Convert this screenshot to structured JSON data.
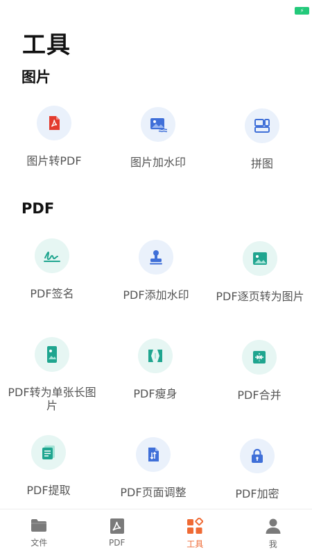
{
  "status": {
    "battery_glyph": "⚡"
  },
  "page_title": "工具",
  "sections": [
    {
      "title": "图片",
      "tools": [
        {
          "label": "图片转PDF",
          "icon": "pdf-file-icon"
        },
        {
          "label": "图片加水印",
          "icon": "image-watermark-icon"
        },
        {
          "label": "拼图",
          "icon": "collage-icon"
        }
      ]
    },
    {
      "title": "PDF",
      "tools": [
        {
          "label": "PDF签名",
          "icon": "signature-icon"
        },
        {
          "label": "PDF添加水印",
          "icon": "stamp-icon"
        },
        {
          "label": "PDF逐页转为图片",
          "icon": "image-icon"
        },
        {
          "label": "PDF转为单张长图片",
          "icon": "long-image-icon"
        },
        {
          "label": "PDF瘦身",
          "icon": "compress-icon"
        },
        {
          "label": "PDF合并",
          "icon": "merge-icon"
        },
        {
          "label": "PDF提取",
          "icon": "extract-icon"
        },
        {
          "label": "PDF页面调整",
          "icon": "page-adjust-icon"
        },
        {
          "label": "PDF加密",
          "icon": "lock-icon"
        }
      ]
    }
  ],
  "tabbar": {
    "active": "tools",
    "items": [
      {
        "id": "files",
        "label": "文件",
        "icon": "folder-icon"
      },
      {
        "id": "pdf",
        "label": "PDF",
        "icon": "pdf-icon"
      },
      {
        "id": "tools",
        "label": "工具",
        "icon": "tools-grid-icon"
      },
      {
        "id": "me",
        "label": "我",
        "icon": "user-icon"
      }
    ]
  },
  "colors": {
    "accent_orange": "#ef6a34",
    "pdf_red": "#e33b2e",
    "icon_blue": "#3f6fd8",
    "icon_teal": "#1fa58f",
    "tab_gray": "#7a7a7a"
  }
}
